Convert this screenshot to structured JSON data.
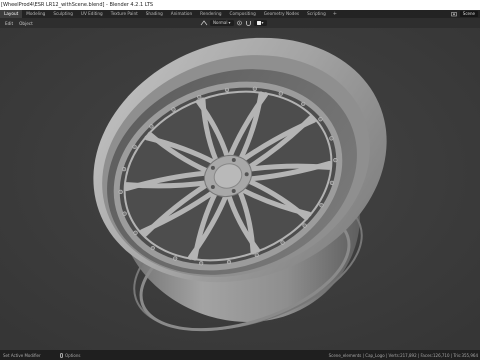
{
  "window": {
    "title": "[WheelProd4\\ESR LR12_withScene.blend] - Blender 4.2.1 LTS"
  },
  "workspace_tabs": [
    {
      "label": "Layout",
      "active": true
    },
    {
      "label": "Modeling",
      "active": false
    },
    {
      "label": "Sculpting",
      "active": false
    },
    {
      "label": "UV Editing",
      "active": false
    },
    {
      "label": "Texture Paint",
      "active": false
    },
    {
      "label": "Shading",
      "active": false
    },
    {
      "label": "Animation",
      "active": false
    },
    {
      "label": "Rendering",
      "active": false
    },
    {
      "label": "Compositing",
      "active": false
    },
    {
      "label": "Geometry Nodes",
      "active": false
    },
    {
      "label": "Scripting",
      "active": false
    }
  ],
  "add_workspace_label": "+",
  "scene": {
    "icon": "scene-icon",
    "name": "Scene"
  },
  "header": {
    "menus": [
      "Edit",
      "Object"
    ],
    "transform_orientation": "Normal",
    "pivot_icon": "pivot-icon",
    "snap_icon": "magnet-icon"
  },
  "viewport": {
    "background_color": "#3d3d3d",
    "shading": "solid"
  },
  "statusbar": {
    "left": "Set Active Modifier",
    "middle_icon": "mouse-icon",
    "middle": "Options",
    "right": "Scene_elements | Cap_Logo | Verts:217,892 | Faces:126,710 | Tris:355,964"
  },
  "colors": {
    "titlebar": "#ffffff",
    "topbar": "#232323",
    "header": "#2e2e2e",
    "statusbar": "#1f1f1f",
    "wheel_light": "#a9a9a9",
    "wheel_dark": "#6e6e6e"
  }
}
